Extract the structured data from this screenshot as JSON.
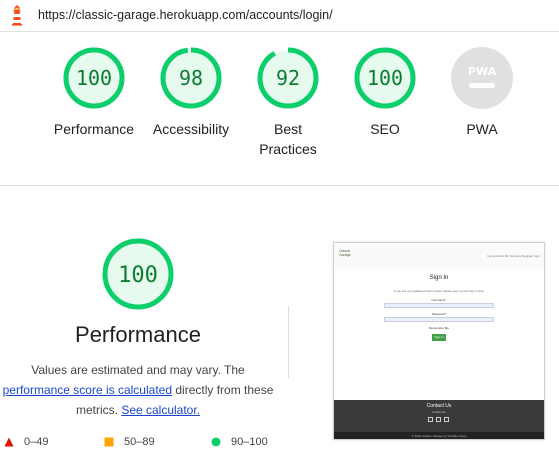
{
  "url": "https://classic-garage.herokuapp.com/accounts/login/",
  "categories": [
    {
      "name": "performance",
      "label": "Performance",
      "score": 100
    },
    {
      "name": "accessibility",
      "label": "Accessibility",
      "score": 98
    },
    {
      "name": "best-practices",
      "label": "Best Practices",
      "score": 92
    },
    {
      "name": "seo",
      "label": "SEO",
      "score": 100
    }
  ],
  "pwa": {
    "label": "PWA",
    "badge": "PWA"
  },
  "detail": {
    "score": 100,
    "title": "Performance",
    "desc_1": "Values are estimated and may vary. The",
    "desc_link_1": "performance score is calculated",
    "desc_2": "directly from these metrics.",
    "desc_link_2": "See calculator."
  },
  "legend": [
    {
      "range": "0–49",
      "color": "#eb0f00",
      "shape": "triangle"
    },
    {
      "range": "50–89",
      "color": "#ffa400",
      "shape": "square"
    },
    {
      "range": "90–100",
      "color": "#0cce6b",
      "shape": "circle"
    }
  ],
  "colors": {
    "pass": "#0cce6b",
    "pass_fill": "#e6fbee",
    "pass_text": "#0c7c30",
    "gray": "#e0e0e0"
  },
  "thumbnail": {
    "logo": "Classic Garage",
    "nav": "Home  About  My Services  Register  Sign",
    "title": "Sign In",
    "subtitle": "If you are not registered with us then please sign up and sign in first.",
    "username_label": "Username*",
    "password_label": "Password*",
    "remember_label": "Remember Me",
    "button": "Sign In",
    "footer_title": "Contact Us",
    "footer_sub": "Follow Us",
    "copyright": "© 2022 Classic Garage by Vivchko Puppi"
  }
}
